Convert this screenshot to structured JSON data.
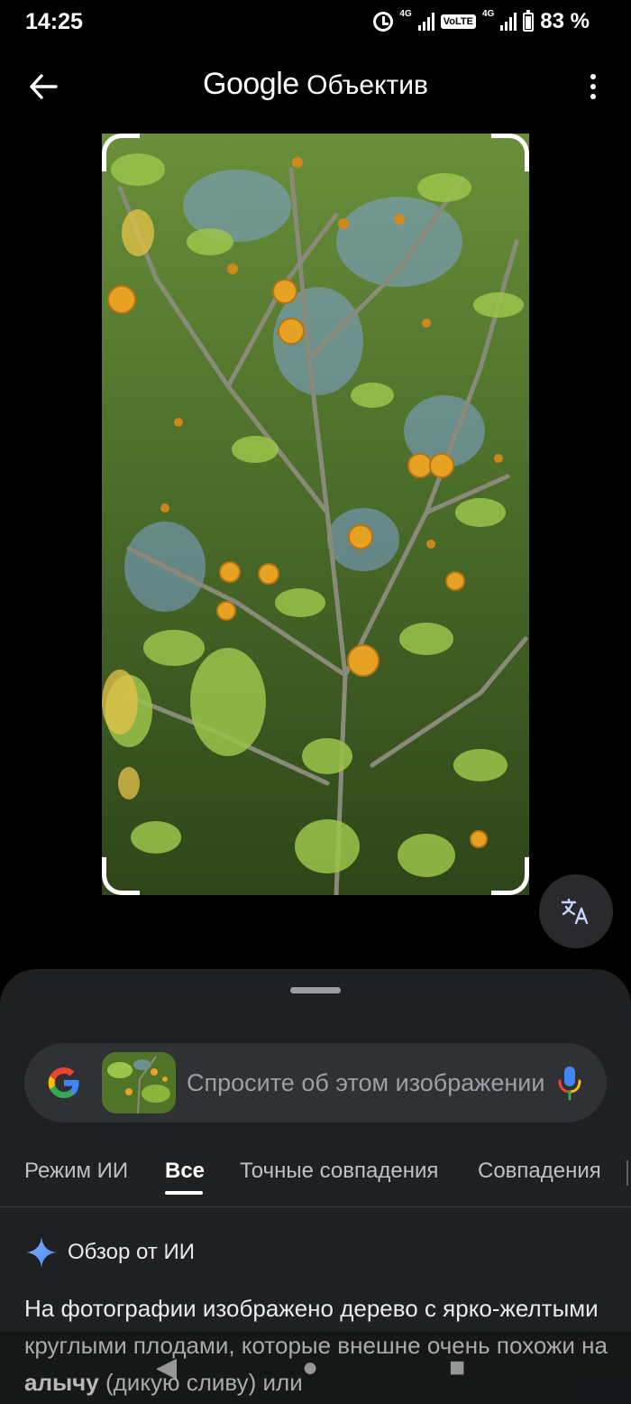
{
  "status_bar": {
    "time": "14:25",
    "network_1": "4G",
    "volte": "VoLTE",
    "network_2": "4G",
    "battery": "83 %"
  },
  "app_bar": {
    "brand": "Google",
    "product": "Объектив"
  },
  "search": {
    "placeholder": "Спросите об этом изображении"
  },
  "tabs": [
    {
      "label": "Режим ИИ",
      "active": false
    },
    {
      "label": "Все",
      "active": true
    },
    {
      "label": "Точные совпадения",
      "active": false
    },
    {
      "label": "Совпадения",
      "active": false
    }
  ],
  "ai_overview": {
    "title": "Обзор от ИИ",
    "text_before": "На фотографии изображено дерево с ярко-желтыми круглыми плодами, которые внешне очень похожи на ",
    "text_bold": "алычу",
    "text_after": " (дикую сливу) или"
  },
  "nav_bar": {
    "back": "◀",
    "home": "●",
    "recents": "■"
  },
  "colors": {
    "sheet_bg": "#1f2021",
    "search_bg": "#303134",
    "accent_blue": "#4285f4"
  }
}
